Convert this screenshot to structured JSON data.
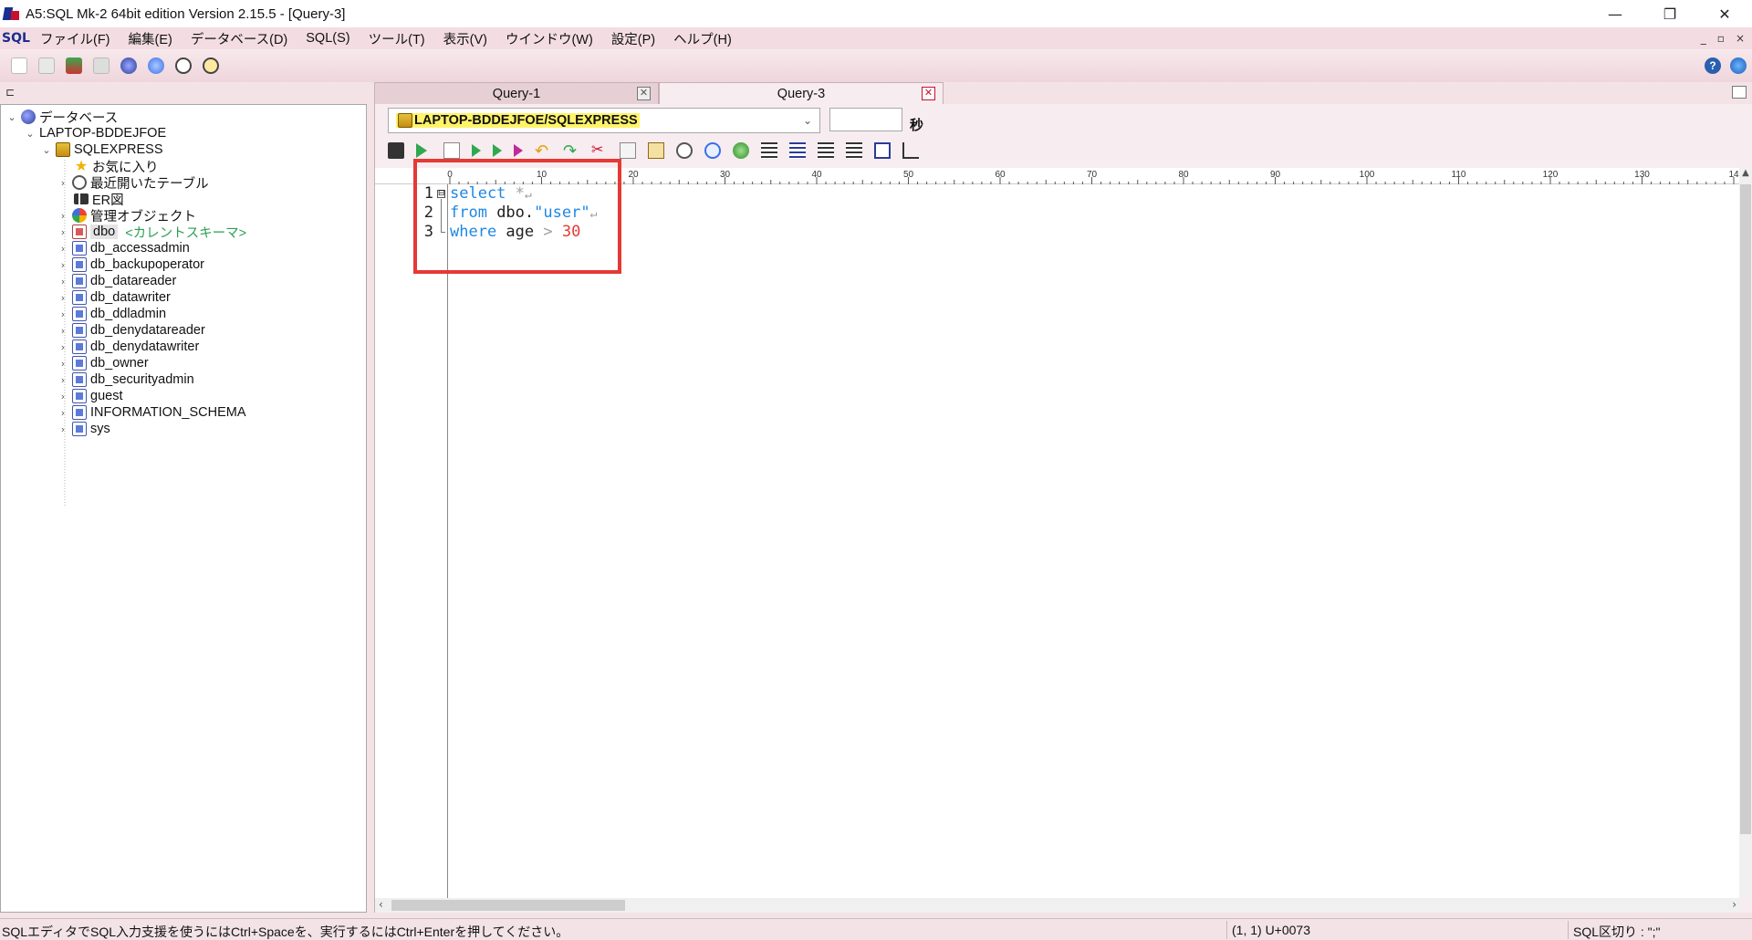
{
  "window": {
    "title": "A5:SQL Mk-2 64bit edition Version 2.15.5 - [Query-3]",
    "minimize": "—",
    "maximize": "❐",
    "close": "✕"
  },
  "menu": {
    "logo": "SQL",
    "items": [
      "ファイル(F)",
      "編集(E)",
      "データベース(D)",
      "SQL(S)",
      "ツール(T)",
      "表示(V)",
      "ウインドウ(W)",
      "設定(P)",
      "ヘルプ(H)"
    ],
    "mdi": [
      "_",
      "▫",
      "×"
    ]
  },
  "toolbar": {
    "help": "?"
  },
  "tree": {
    "root": "データベース",
    "server": "LAPTOP-BDDEJFOE",
    "instance": "SQLEXPRESS",
    "favorites": "お気に入り",
    "recent": "最近開いたテーブル",
    "er": "ER図",
    "admin": "管理オブジェクト",
    "dbo": "dbo",
    "current_schema": "<カレントスキーマ>",
    "schemas": [
      "db_accessadmin",
      "db_backupoperator",
      "db_datareader",
      "db_datawriter",
      "db_ddladmin",
      "db_denydatareader",
      "db_denydatawriter",
      "db_owner",
      "db_securityadmin",
      "guest",
      "INFORMATION_SCHEMA",
      "sys"
    ]
  },
  "tabs": [
    {
      "label": "Query-1",
      "active": false
    },
    {
      "label": "Query-3",
      "active": true
    }
  ],
  "tab_close": "✕",
  "connection": {
    "value": "LAPTOP-BDDEJFOE/SQLEXPRESS",
    "timeout_value": "",
    "timeout_unit": "秒"
  },
  "ruler": {
    "labels": [
      "0",
      "10",
      "20",
      "30",
      "40",
      "50",
      "60",
      "70",
      "80",
      "90",
      "100",
      "110",
      "120",
      "130",
      "14"
    ]
  },
  "editor": {
    "line_numbers": [
      "1",
      "2",
      "3"
    ],
    "fold_mark": "⊟",
    "lines": [
      {
        "kw": "select",
        "rest_op": " *",
        "eol": "↵"
      },
      {
        "kw": "from",
        "id": " dbo.",
        "str": "\"user\"",
        "eol": "↵"
      },
      {
        "kw": "where",
        "id": " age ",
        "op": ">",
        "num": " 30"
      }
    ]
  },
  "status": {
    "message": "SQLエディタでSQL入力支援を使うにはCtrl+Spaceを、実行するにはCtrl+Enterを押してください。",
    "position": "(1, 1) U+0073",
    "separator": "SQL区切り : \";\""
  },
  "colors": {
    "keyword": "#1e88e5",
    "number": "#e53935",
    "highlight_box": "#e53935",
    "connection_bg": "#fff36a",
    "chrome_pink": "#f3e3e7"
  }
}
